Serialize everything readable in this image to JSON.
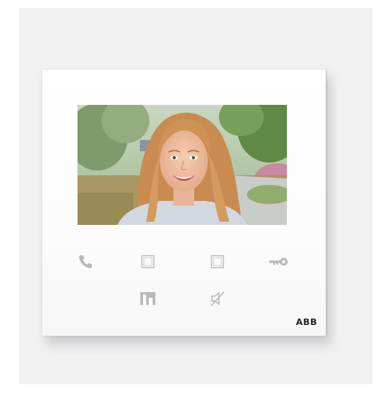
{
  "device": {
    "brand_logo": "ABB",
    "screen": {
      "content": "video-call-feed"
    },
    "buttons": {
      "call": {
        "icon": "phone-icon"
      },
      "programmable_1": {
        "icon": "square-icon"
      },
      "programmable_2": {
        "icon": "square-icon"
      },
      "door_unlock": {
        "icon": "key-icon"
      },
      "surveillance": {
        "icon": "door-icon"
      },
      "mute": {
        "icon": "mute-speaker-icon"
      }
    },
    "colors": {
      "panel": "#ffffff",
      "icon": "#b9b9bb",
      "background": "#f1f1f2"
    }
  }
}
